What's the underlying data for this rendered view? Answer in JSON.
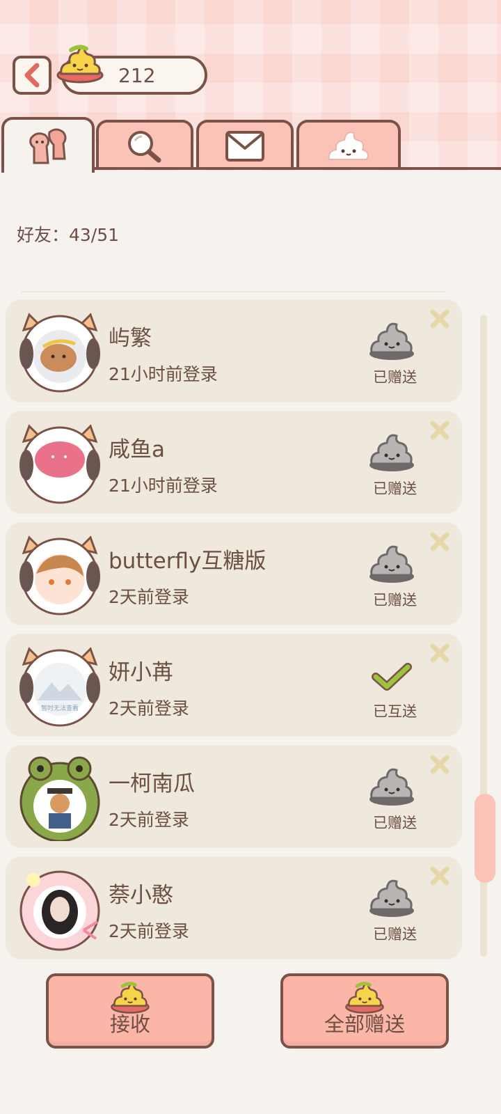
{
  "header": {
    "coins": "212"
  },
  "tabs": [
    {
      "icon": "friends-icon"
    },
    {
      "icon": "search-icon"
    },
    {
      "icon": "mail-icon"
    },
    {
      "icon": "poop-icon"
    }
  ],
  "friends_label": "好友：43/51",
  "friends": [
    {
      "name": "屿繁",
      "login": "21小时前登录",
      "status": "已赠送",
      "status_icon": "gray-poop-icon",
      "avatar": "bear-in-sheep-frame"
    },
    {
      "name": "咸鱼a",
      "login": "21小时前登录",
      "status": "已赠送",
      "status_icon": "gray-poop-icon",
      "avatar": "pink-blob-in-sheep-frame"
    },
    {
      "name": "butterfly互糖版",
      "login": "2天前登录",
      "status": "已赠送",
      "status_icon": "gray-poop-icon",
      "avatar": "boy-in-sheep-frame"
    },
    {
      "name": "妍小苒",
      "login": "2天前登录",
      "status": "已互送",
      "status_icon": "check-icon",
      "avatar": "placeholder-in-sheep-frame",
      "avatar_text": "暂时无法查看"
    },
    {
      "name": "一柯南瓜",
      "login": "2天前登录",
      "status": "已赠送",
      "status_icon": "gray-poop-icon",
      "avatar": "man-in-frog-frame"
    },
    {
      "name": "萘小憨",
      "login": "2天前登录",
      "status": "已赠送",
      "status_icon": "gray-poop-icon",
      "avatar": "girl-in-flower-frame"
    }
  ],
  "buttons": {
    "receive": "接收",
    "give_all": "全部赠送"
  },
  "colors": {
    "accent": "#fbc3b7",
    "outline": "#7a5248",
    "card": "#efe8dd",
    "check": "#9bc43a"
  }
}
